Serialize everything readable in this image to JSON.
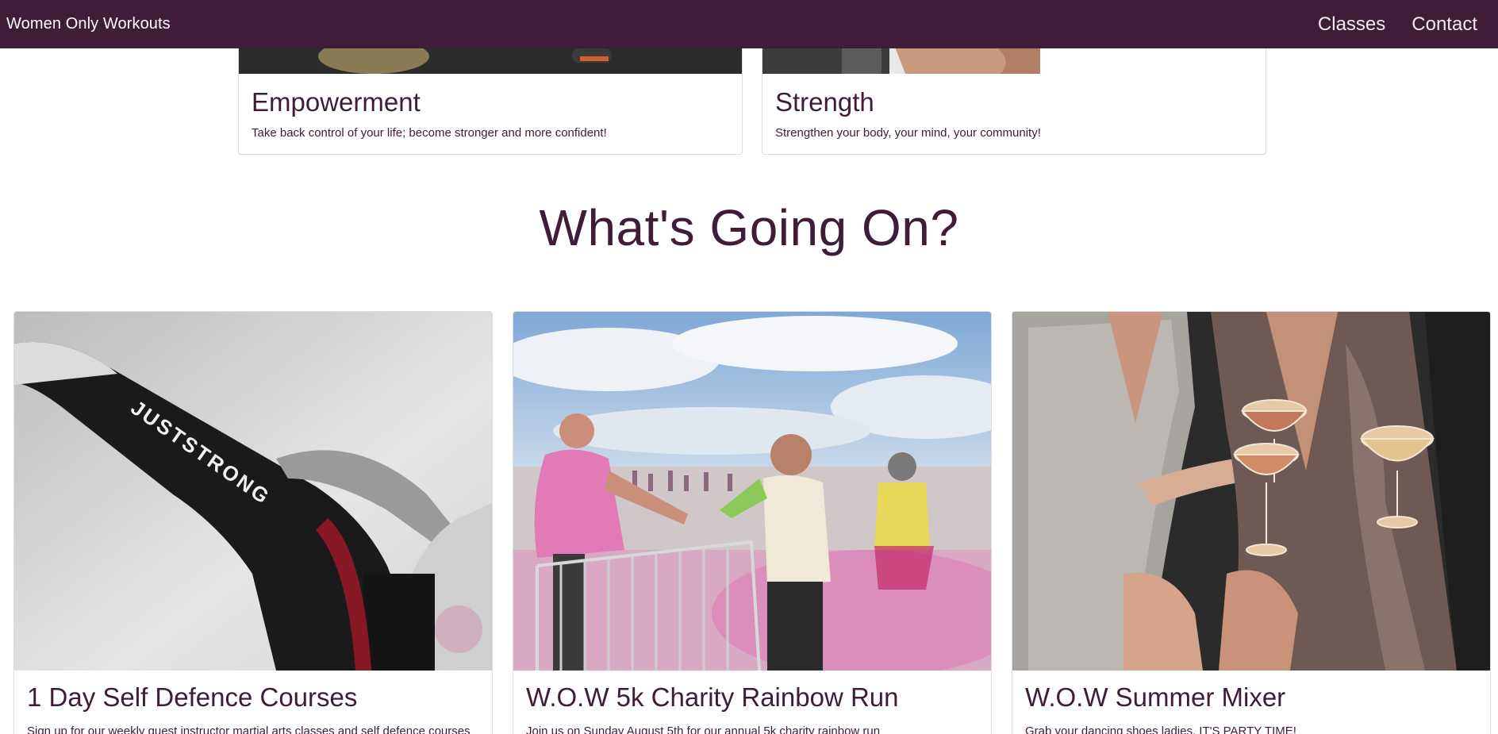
{
  "navbar": {
    "brand": "Women Only Workouts",
    "links": [
      "Classes",
      "Contact"
    ]
  },
  "features": [
    {
      "title": "Empowerment",
      "text": "Take back control of your life; become stronger and more confident!"
    },
    {
      "title": "Strength",
      "text": "Strengthen your body, your mind, your community!"
    }
  ],
  "events_section": {
    "title": "What's Going On?",
    "events": [
      {
        "title": "1 Day Self Defence Courses",
        "text": "Sign up for our weekly guest instructor martial arts classes and self defence courses",
        "image_text": "JUSTSTRONG"
      },
      {
        "title": "W.O.W 5k Charity Rainbow Run",
        "text": "Join us on Sunday August 5th for our annual 5k charity rainbow run"
      },
      {
        "title": "W.O.W Summer Mixer",
        "text": "Grab your dancing shoes ladies, IT'S PARTY TIME!"
      }
    ]
  },
  "colors": {
    "brand": "#3f1c38",
    "text": "#3f1c38",
    "background": "#ffffff",
    "card_border": "#dcdcdc"
  }
}
